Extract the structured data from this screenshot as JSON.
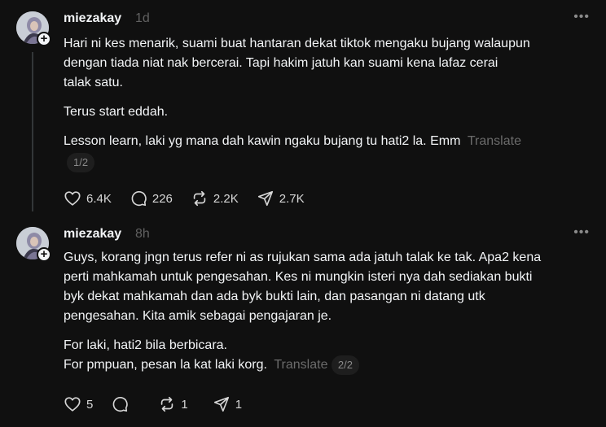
{
  "posts": [
    {
      "username": "miezakay",
      "timestamp": "1d",
      "paragraphs": [
        "Hari ni kes menarik, suami buat hantaran dekat tiktok mengaku bujang walaupun\ndengan tiada niat nak bercerai. Tapi hakim jatuh kan suami kena lafaz cerai\ntalak satu.",
        "Terus start eddah."
      ],
      "last_paragraph": "Lesson learn, laki yg mana dah kawin ngaku bujang tu hati2 la. Emm",
      "translate": "Translate",
      "page": "1/2",
      "likes": "6.4K",
      "replies": "226",
      "reposts": "2.2K",
      "shares": "2.7K"
    },
    {
      "username": "miezakay",
      "timestamp": "8h",
      "paragraphs": [
        "Guys, korang jngn terus refer ni as rujukan sama ada jatuh talak ke tak. Apa2 kena\nperti mahkamah untuk pengesahan. Kes ni mungkin isteri nya dah sediakan bukti\nbyk dekat mahkamah dan ada byk bukti lain, dan pasangan ni datang utk\npengesahan. Kita amik sebagai pengajaran je."
      ],
      "last_paragraph": "For laki, hati2 bila berbicara.\nFor pmpuan, pesan la kat laki korg.",
      "translate": "Translate",
      "page": "2/2",
      "likes": "5",
      "replies": "",
      "reposts": "1",
      "shares": "1"
    }
  ],
  "icons": {
    "more": "more-horizontal-icon",
    "like": "heart-icon",
    "reply": "comment-bubble-icon",
    "repost": "repost-arrows-icon",
    "share": "paper-plane-icon",
    "follow": "plus-icon"
  },
  "colors": {
    "background": "#101010",
    "text": "#f3f5f7",
    "muted": "#616161",
    "thread_line": "#333638"
  }
}
